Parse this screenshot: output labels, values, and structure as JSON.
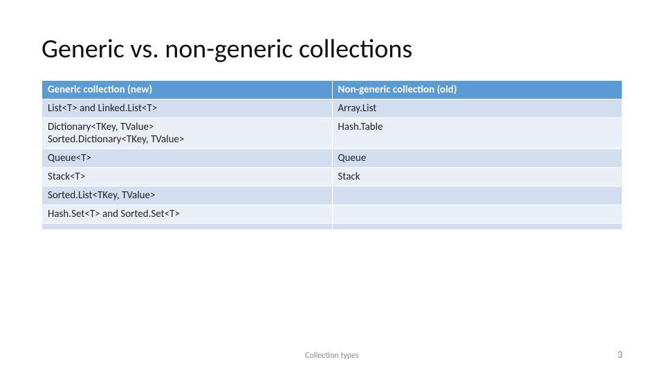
{
  "title": "Generic vs. non-generic collections",
  "table": {
    "header": {
      "col0": "Generic collection (new)",
      "col1": "Non-generic collection (old)"
    },
    "rows": [
      {
        "col0": "List<T> and Linked.List<T>",
        "col1": "Array.List"
      },
      {
        "col0": "Dictionary<TKey, TValue>\nSorted.Dictionary<TKey, TValue>",
        "col1": "Hash.Table"
      },
      {
        "col0": "Queue<T>",
        "col1": "Queue"
      },
      {
        "col0": "Stack<T>",
        "col1": "Stack"
      },
      {
        "col0": "Sorted.List<TKey, TValue>",
        "col1": ""
      },
      {
        "col0": "Hash.Set<T> and Sorted.Set<T>",
        "col1": ""
      },
      {
        "col0": "",
        "col1": ""
      }
    ]
  },
  "footer": {
    "center": "Collection types",
    "right": "3"
  }
}
